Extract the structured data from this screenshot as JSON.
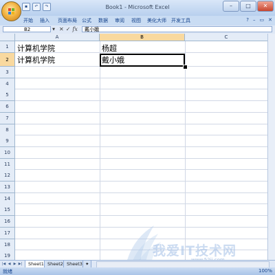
{
  "window": {
    "title": "Book1 - Microsoft Excel"
  },
  "quick_access": [
    "save",
    "undo",
    "redo"
  ],
  "ribbon_tabs": [
    "开始",
    "插入",
    "页面布局",
    "公式",
    "数据",
    "审阅",
    "视图",
    "美化大师",
    "开发工具"
  ],
  "formula_bar": {
    "name_box": "B2",
    "fx_label": "fx",
    "content": "戴小娥"
  },
  "columns": [
    "A",
    "B",
    "C"
  ],
  "selected_column": "B",
  "rows": [
    "1",
    "2",
    "3",
    "4",
    "5",
    "6",
    "7",
    "8",
    "9",
    "10",
    "11",
    "12",
    "13",
    "14",
    "15",
    "16",
    "17",
    "18",
    "19"
  ],
  "selected_row": "2",
  "cells": {
    "A1": "计算机学院",
    "B1": "杨超",
    "A2": "计算机学院",
    "B2": "戴小娥"
  },
  "sheets": [
    "Sheet1",
    "Sheet2",
    "Sheet3"
  ],
  "active_sheet": "Sheet1",
  "status": {
    "mode": "就绪",
    "zoom": "100%"
  },
  "watermark": {
    "text": "我爱IT技术网",
    "url": "www.52ij.com"
  },
  "colors": {
    "selected_header": "#f9d99f",
    "grid": "#d0d7e5",
    "header_bg": "#e4ecf7"
  }
}
